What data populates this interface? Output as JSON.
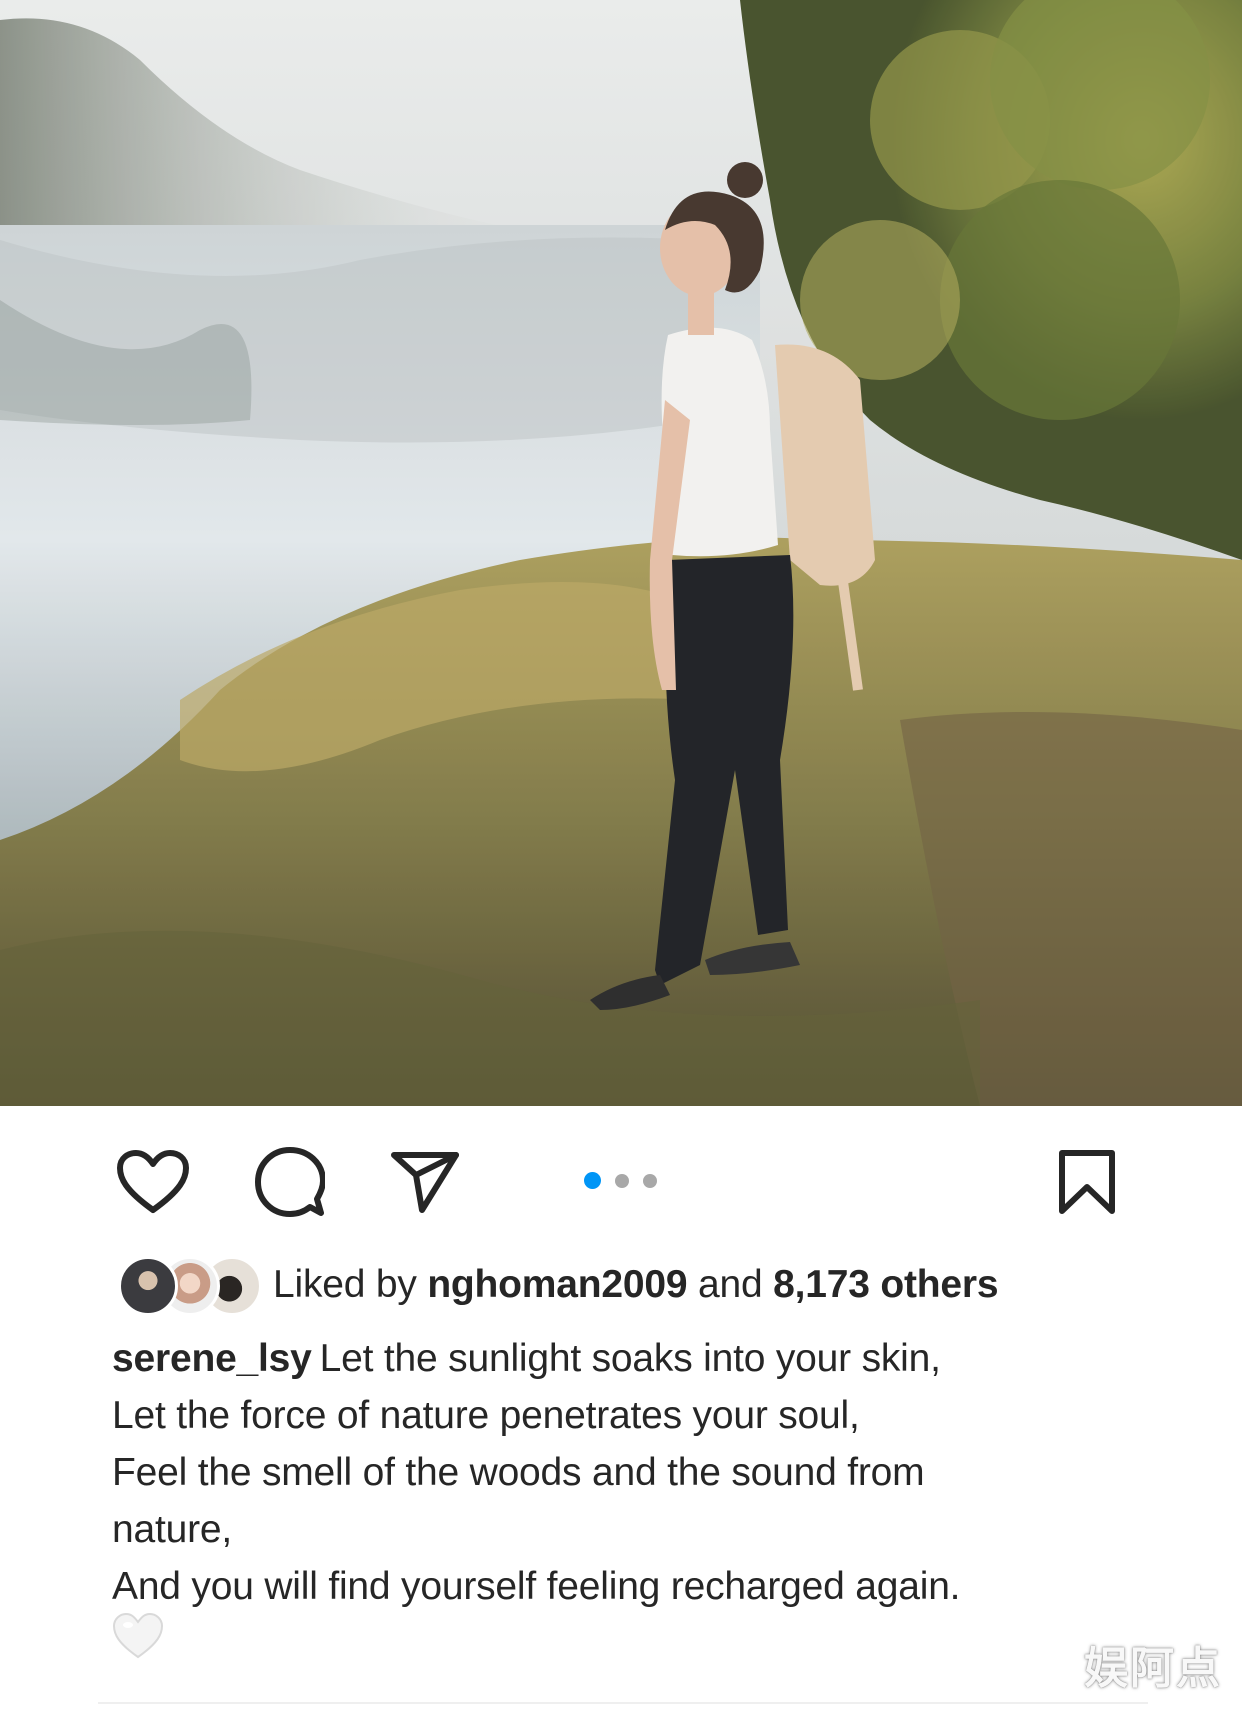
{
  "post": {
    "image": {
      "description_icon": "photo-woman-by-lake-icon"
    },
    "actions": {
      "like_icon": "heart-outline-icon",
      "comment_icon": "comment-bubble-icon",
      "share_icon": "paper-plane-icon",
      "save_icon": "bookmark-icon"
    },
    "carousel": {
      "count": 3,
      "active_index": 0,
      "active_color": "#0095f6",
      "inactive_color": "#a8a8a8"
    },
    "likes": {
      "prefix": "Liked by",
      "first_user": "nghoman2009",
      "connector": "and",
      "others": "8,173 others"
    },
    "caption": {
      "username": "serene_lsy",
      "line1": "Let the sunlight soaks into your skin,",
      "line2": "Let the force of nature penetrates your soul,",
      "line3": "Feel the smell of the woods and the sound from",
      "line4": "nature,",
      "line5": "And you will find yourself feeling recharged again.",
      "emoji": "🤍"
    }
  },
  "watermark": {
    "text": "娱阿点"
  }
}
